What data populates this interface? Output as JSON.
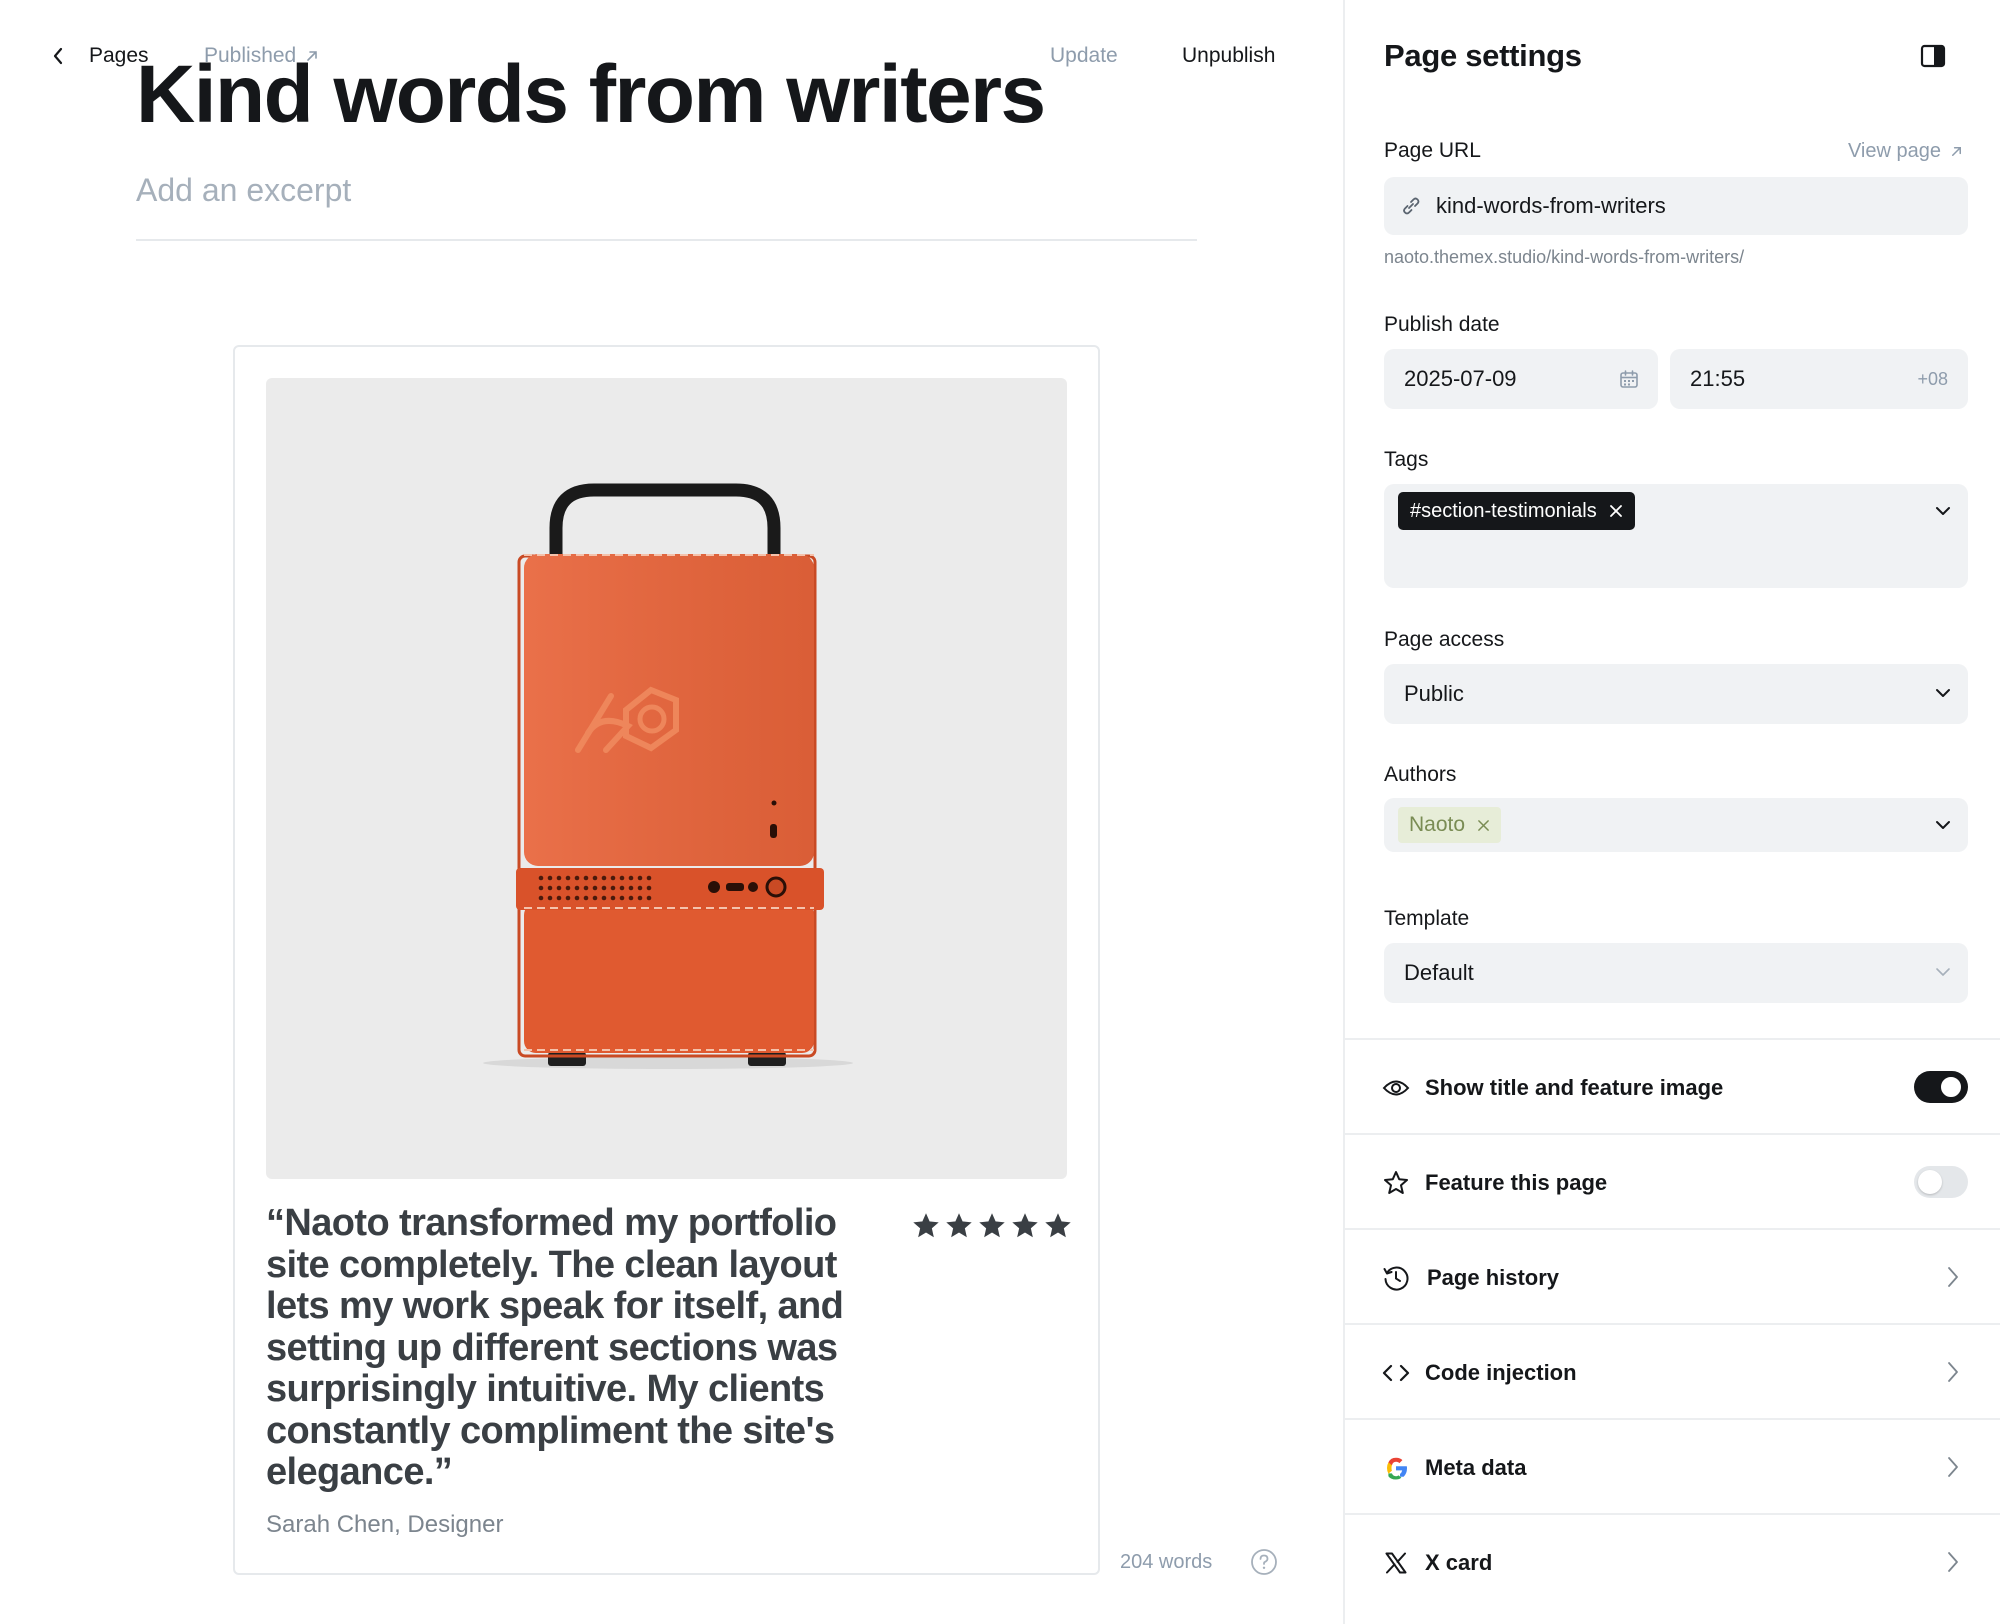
{
  "header": {
    "back_label": "Pages",
    "status": "Published",
    "update_label": "Update",
    "unpublish_label": "Unpublish"
  },
  "post": {
    "title": "Kind words from writers",
    "excerpt_placeholder": "Add an excerpt"
  },
  "testimonial": {
    "quote": "“Naoto transformed my portfolio site completely. The clean layout lets my work speak for itself, and setting up different sections was surprisingly intuitive. My clients constantly compliment the site's elegance.”",
    "author": "Sarah Chen, Designer",
    "rating": 5,
    "rating_max": 5,
    "image_subject": "orange computer case with handle"
  },
  "footer": {
    "word_count": "204 words"
  },
  "settings": {
    "title": "Page settings",
    "page_url_label": "Page URL",
    "view_page_label": "View page",
    "slug": "kind-words-from-writers",
    "full_url": "naoto.themex.studio/kind-words-from-writers/",
    "publish_date_label": "Publish date",
    "date": "2025-07-09",
    "time": "21:55",
    "timezone": "+08",
    "tags_label": "Tags",
    "tags": [
      "#section-testimonials"
    ],
    "page_access_label": "Page access",
    "page_access_value": "Public",
    "authors_label": "Authors",
    "authors": [
      "Naoto"
    ],
    "template_label": "Template",
    "template_value": "Default",
    "rows": {
      "show_title": {
        "label": "Show title and feature image",
        "enabled": true
      },
      "feature": {
        "label": "Feature this page",
        "enabled": false
      },
      "history": {
        "label": "Page history"
      },
      "code": {
        "label": "Code injection"
      },
      "meta": {
        "label": "Meta data"
      },
      "xcard": {
        "label": "X card"
      }
    }
  },
  "colors": {
    "text": "#15171a",
    "muted": "#8e9cac",
    "field_bg": "#f0f2f4",
    "accent_orange": "#e0582e",
    "author_chip_bg": "#e7edd8",
    "author_chip_text": "#7a8c54"
  }
}
